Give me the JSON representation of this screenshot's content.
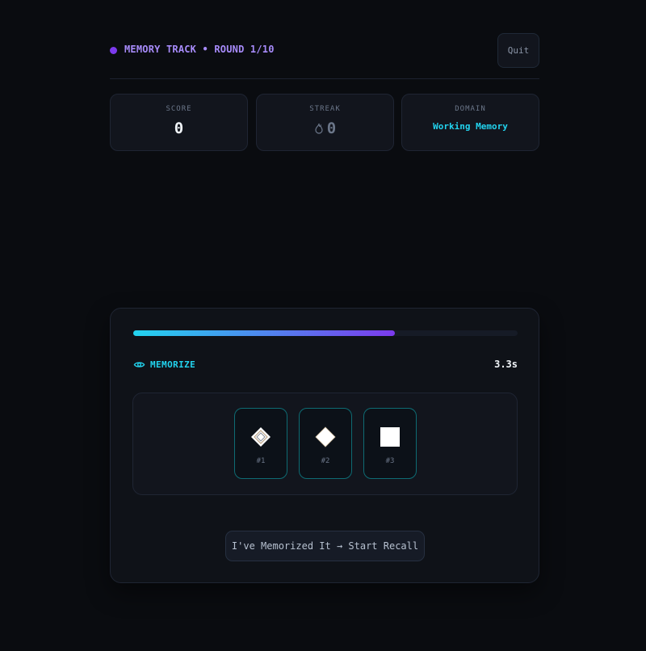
{
  "header": {
    "track_label": "MEMORY TRACK • ROUND 1/10",
    "quit_label": "Quit"
  },
  "stats": {
    "score": {
      "title": "SCORE",
      "value": "0"
    },
    "streak": {
      "title": "STREAK",
      "value": "0",
      "icon": "flame-icon"
    },
    "domain": {
      "title": "DOMAIN",
      "value": "Working Memory"
    }
  },
  "game": {
    "progress": 0.68,
    "phase_icon": "eye-icon",
    "phase_label": "MEMORIZE",
    "timer": "3.3s",
    "items": [
      {
        "label": "#1",
        "shape": "diamond-outline"
      },
      {
        "label": "#2",
        "shape": "diamond"
      },
      {
        "label": "#3",
        "shape": "square"
      }
    ],
    "recall_button_label": "I've Memorized It → Start Recall"
  },
  "colors": {
    "accent_cyan": "#22d3ee",
    "accent_purple": "#7c3aed",
    "background": "#0a0c10"
  }
}
